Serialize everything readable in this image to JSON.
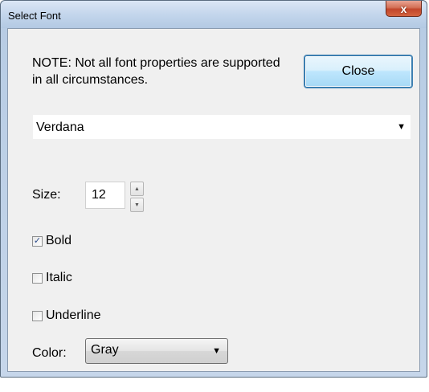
{
  "window": {
    "title": "Select Font",
    "close_glyph": "x"
  },
  "note": {
    "text": "NOTE: Not all font properties are supported in all circumstances."
  },
  "close_button": {
    "label": "Close"
  },
  "font_select": {
    "value": "Verdana",
    "arrow": "▼"
  },
  "size": {
    "label": "Size:",
    "value": "12",
    "up": "▲",
    "down": "▼"
  },
  "checkboxes": {
    "bold": {
      "label": "Bold",
      "checked": true,
      "mark": "✓"
    },
    "italic": {
      "label": "Italic",
      "checked": false,
      "mark": ""
    },
    "underline": {
      "label": "Underline",
      "checked": false,
      "mark": ""
    }
  },
  "color": {
    "label": "Color:",
    "value": "Gray",
    "arrow": "▼"
  }
}
